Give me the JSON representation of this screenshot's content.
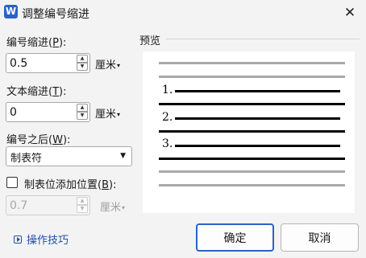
{
  "window": {
    "title": "调整编号缩进",
    "app_icon_letter": "W",
    "close_glyph": "✕"
  },
  "number_indent": {
    "label": "编号缩进",
    "shortcut": "P",
    "value": "0.5",
    "unit": "厘米"
  },
  "text_indent": {
    "label": "文本缩进",
    "shortcut": "T",
    "value": "0",
    "unit": "厘米"
  },
  "after_number": {
    "label": "编号之后",
    "shortcut": "W",
    "selected": "制表符"
  },
  "tab_position": {
    "label": "制表位添加位置",
    "shortcut": "B",
    "checked": false,
    "value": "0.7",
    "unit": "厘米"
  },
  "preview": {
    "label": "预览",
    "numbers": [
      "1.",
      "2.",
      "3."
    ]
  },
  "footer": {
    "tips_label": "操作技巧",
    "ok_label": "确定",
    "cancel_label": "取消"
  },
  "colors": {
    "accent": "#2b62c9",
    "link": "#1f4fa8",
    "background": "#f3f3f3"
  }
}
